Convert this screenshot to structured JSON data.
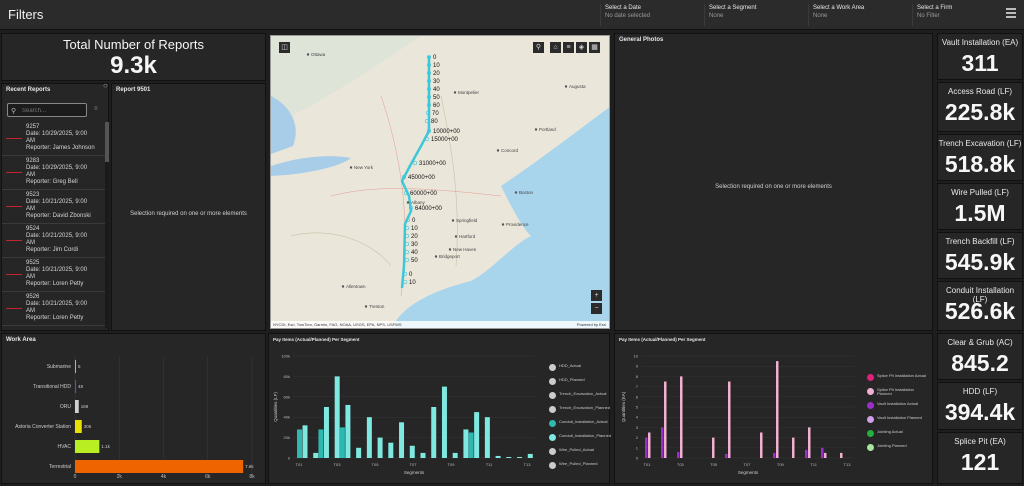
{
  "header": {
    "title": "Filters",
    "filters": [
      {
        "label": "Select a Date",
        "value": "No date selected"
      },
      {
        "label": "Select a Segment",
        "value": "None"
      },
      {
        "label": "Select a Work Area",
        "value": "None"
      },
      {
        "label": "Select a Firm",
        "value": "No Filter"
      }
    ]
  },
  "total": {
    "title": "Total Number of Reports",
    "value": "9.3k"
  },
  "recent": {
    "title": "Recent Reports",
    "search_placeholder": "Search...",
    "items": [
      {
        "id": "9257",
        "date": "Date: 10/29/2025, 9:00",
        "ampm": "AM",
        "reporter": "Reporter: James Johnson"
      },
      {
        "id": "9283",
        "date": "Date: 10/29/2025, 9:00",
        "ampm": "AM",
        "reporter": "Reporter: Greg Bell"
      },
      {
        "id": "9523",
        "date": "Date: 10/21/2025, 9:00",
        "ampm": "AM",
        "reporter": "Reporter: David Zbonski"
      },
      {
        "id": "9524",
        "date": "Date: 10/21/2025, 9:00",
        "ampm": "AM",
        "reporter": "Reporter: Jim Cordi"
      },
      {
        "id": "9525",
        "date": "Date: 10/21/2025, 9:00",
        "ampm": "AM",
        "reporter": "Reporter: Loren Petty"
      },
      {
        "id": "9526",
        "date": "Date: 10/21/2025, 9:00",
        "ampm": "AM",
        "reporter": "Reporter: Loren Petty"
      }
    ]
  },
  "report_detail": {
    "title": "Report 9501",
    "message": "Selection required on one or more elements"
  },
  "photos": {
    "title": "General Photos",
    "message": "Selection required on one or more elements"
  },
  "map": {
    "attribution": "NYCDI, Esri, TomTom, Garmin, FAO, NOAA, USGS, EPA, NPS, USFWS",
    "powered": "Powered by Esri",
    "places": [
      {
        "name": "Montpelier",
        "x": 187,
        "y": 58
      },
      {
        "name": "Augusta",
        "x": 298,
        "y": 52
      },
      {
        "name": "Portland",
        "x": 268,
        "y": 95
      },
      {
        "name": "Concord",
        "x": 230,
        "y": 116
      },
      {
        "name": "Albany",
        "x": 140,
        "y": 168
      },
      {
        "name": "Springfield",
        "x": 185,
        "y": 186
      },
      {
        "name": "Boston",
        "x": 248,
        "y": 158
      },
      {
        "name": "Providence",
        "x": 235,
        "y": 190
      },
      {
        "name": "Hartford",
        "x": 188,
        "y": 202
      },
      {
        "name": "New Haven",
        "x": 182,
        "y": 215
      },
      {
        "name": "Bridgeport",
        "x": 168,
        "y": 222
      },
      {
        "name": "New York",
        "x": 83,
        "y": 133
      },
      {
        "name": "Allentown",
        "x": 75,
        "y": 252
      },
      {
        "name": "Trenton",
        "x": 98,
        "y": 272
      },
      {
        "name": "Ottawa",
        "x": 40,
        "y": 20
      }
    ],
    "labels": [
      {
        "text": "0",
        "x": 158,
        "y": 23
      },
      {
        "text": "10",
        "x": 158,
        "y": 31
      },
      {
        "text": "20",
        "x": 158,
        "y": 39
      },
      {
        "text": "30",
        "x": 158,
        "y": 47
      },
      {
        "text": "40",
        "x": 158,
        "y": 55
      },
      {
        "text": "50",
        "x": 158,
        "y": 63
      },
      {
        "text": "60",
        "x": 158,
        "y": 71
      },
      {
        "text": "70",
        "x": 157,
        "y": 79
      },
      {
        "text": "80",
        "x": 156,
        "y": 87
      },
      {
        "text": "10000+00",
        "x": 158,
        "y": 97
      },
      {
        "text": "15000+00",
        "x": 156,
        "y": 105
      },
      {
        "text": "31000+00",
        "x": 144,
        "y": 129
      },
      {
        "text": "45000+00",
        "x": 133,
        "y": 143
      },
      {
        "text": "60000+00",
        "x": 135,
        "y": 159
      },
      {
        "text": "64000+00",
        "x": 140,
        "y": 174
      },
      {
        "text": "0",
        "x": 137,
        "y": 186
      },
      {
        "text": "10",
        "x": 136,
        "y": 194
      },
      {
        "text": "20",
        "x": 136,
        "y": 202
      },
      {
        "text": "30",
        "x": 136,
        "y": 210
      },
      {
        "text": "40",
        "x": 136,
        "y": 218
      },
      {
        "text": "50",
        "x": 136,
        "y": 226
      },
      {
        "text": "0",
        "x": 134,
        "y": 240
      },
      {
        "text": "10",
        "x": 134,
        "y": 248
      }
    ]
  },
  "kpis": [
    {
      "label": "Vault Installation (EA)",
      "value": "311"
    },
    {
      "label": "Access Road (LF)",
      "value": "225.8k"
    },
    {
      "label": "Trench Excavation (LF)",
      "value": "518.8k"
    },
    {
      "label": "Wire Pulled (LF)",
      "value": "1.5M"
    },
    {
      "label": "Trench Backfill (LF)",
      "value": "545.9k"
    },
    {
      "label": "Conduit Installation (LF)",
      "value": "526.6k"
    },
    {
      "label": "Clear & Grub (AC)",
      "value": "845.2"
    },
    {
      "label": "HDD (LF)",
      "value": "394.4k"
    },
    {
      "label": "Splice Pit (EA)",
      "value": "121"
    }
  ],
  "chart_data": [
    {
      "type": "bar",
      "orientation": "horizontal",
      "title": "Work Area",
      "categories": [
        "Submarine",
        "Transitional HDD",
        "ORU",
        "Astoria Converter Station",
        "HVAC",
        "Terrestrial"
      ],
      "values": [
        5,
        48,
        169,
        306,
        1100,
        7600
      ],
      "data_labels": [
        "5",
        "48",
        "169",
        "306",
        "1.1k",
        "7.6k"
      ],
      "colors": [
        "#b0b0b0",
        "#9b30c8",
        "#d0d0d0",
        "#e8e000",
        "#b8ee22",
        "#f06400"
      ],
      "xticks": [
        "0",
        "2k",
        "4k",
        "6k",
        "8k"
      ],
      "xlim": [
        0,
        8000
      ]
    },
    {
      "type": "bar",
      "title": "Pay Items (Actual/Planned) Per Segment",
      "xlabel": "Segments",
      "ylabel": "Quantities (LF)",
      "ylim": [
        0,
        100000
      ],
      "yticks": [
        "0",
        "20k",
        "40k",
        "60k",
        "80k",
        "100k"
      ],
      "xticks": [
        "T01",
        "T03",
        "T05",
        "T07",
        "T09",
        "T11",
        "T13"
      ],
      "legend": [
        "HDD_Actual",
        "HDD_Planned",
        "Trench_Excavation_Actual",
        "Trench_Excavation_Planned",
        "Conduit_Installation_Actual",
        "Conduit_Installation_Planned",
        "Wire_Pulled_Actual",
        "Wire_Pulled_Planned"
      ],
      "series": [
        {
          "name": "Conduit_Installation_Actual",
          "color": "#2fb8b0",
          "values": [
            28,
            0,
            28,
            0,
            30,
            0,
            0,
            0,
            0,
            0,
            0,
            0,
            0,
            0,
            0,
            0,
            25,
            0,
            0,
            0,
            0,
            0
          ]
        },
        {
          "name": "Conduit_Installation_Planned",
          "color": "#7fe8e0",
          "values": [
            32,
            5,
            50,
            80,
            52,
            10,
            40,
            20,
            15,
            35,
            12,
            5,
            50,
            70,
            5,
            28,
            45,
            40,
            2,
            1,
            1,
            4
          ]
        }
      ]
    },
    {
      "type": "bar",
      "title": "Pay Items (Actual/Planned) Per Segment",
      "xlabel": "Segments",
      "ylabel": "Quantities (EA)",
      "ylim": [
        0,
        10
      ],
      "yticks": [
        "0",
        "1",
        "2",
        "3",
        "4",
        "5",
        "6",
        "7",
        "8",
        "9",
        "10"
      ],
      "xticks": [
        "T01",
        "T03",
        "T05",
        "T07",
        "T09",
        "T11",
        "T13"
      ],
      "legend": [
        "Splice Pit Installation Actual",
        "Splice Pit Installation Planned",
        "Vault Installation Actual",
        "Vault Installation Planned",
        "Jointing Actual",
        "Jointing Planned"
      ],
      "series": [
        {
          "name": "Vault Installation Actual",
          "color": "#9b30c8",
          "values": [
            2,
            3,
            0.6,
            0,
            0,
            0.4,
            0,
            0,
            0.5,
            0,
            0.8,
            1,
            0
          ]
        },
        {
          "name": "Splice Pit Installation Planned",
          "color": "#f0b0d0",
          "values": [
            2.5,
            7.5,
            8,
            0,
            2,
            7.5,
            0,
            2.5,
            9.5,
            2,
            3,
            0.5,
            0.5
          ]
        }
      ]
    }
  ],
  "legend_colors": {
    "chart2": [
      "#cccccc",
      "#cccccc",
      "#cccccc",
      "#cccccc",
      "#2fb8b0",
      "#7fe8e0",
      "#cccccc",
      "#cccccc"
    ],
    "chart3": [
      "#e0207a",
      "#f0b0d0",
      "#9b30c8",
      "#d0a0e8",
      "#22b040",
      "#a8e6a0"
    ]
  }
}
